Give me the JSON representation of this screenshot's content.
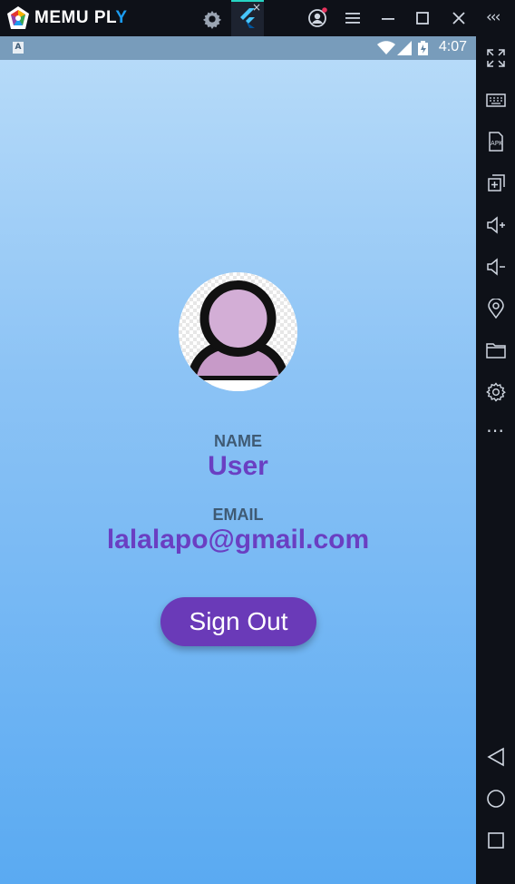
{
  "emulator": {
    "brand_prefix": "MEMU PL",
    "brand_suffix": "Y",
    "tab_close": "×",
    "collapse_label": "‹‹‹",
    "more_label": "⋯"
  },
  "status_bar": {
    "app_indicator": "A",
    "time": "4:07"
  },
  "profile": {
    "name_label": "NAME",
    "name_value": "User",
    "email_label": "EMAIL",
    "email_value": "lalalapo@gmail.com",
    "signout_label": "Sign Out"
  },
  "colors": {
    "accent": "#6a3ab8",
    "value_text": "#6a3fc2",
    "label_text": "#3f5a73",
    "avatar_fill": "#d3aed6"
  }
}
